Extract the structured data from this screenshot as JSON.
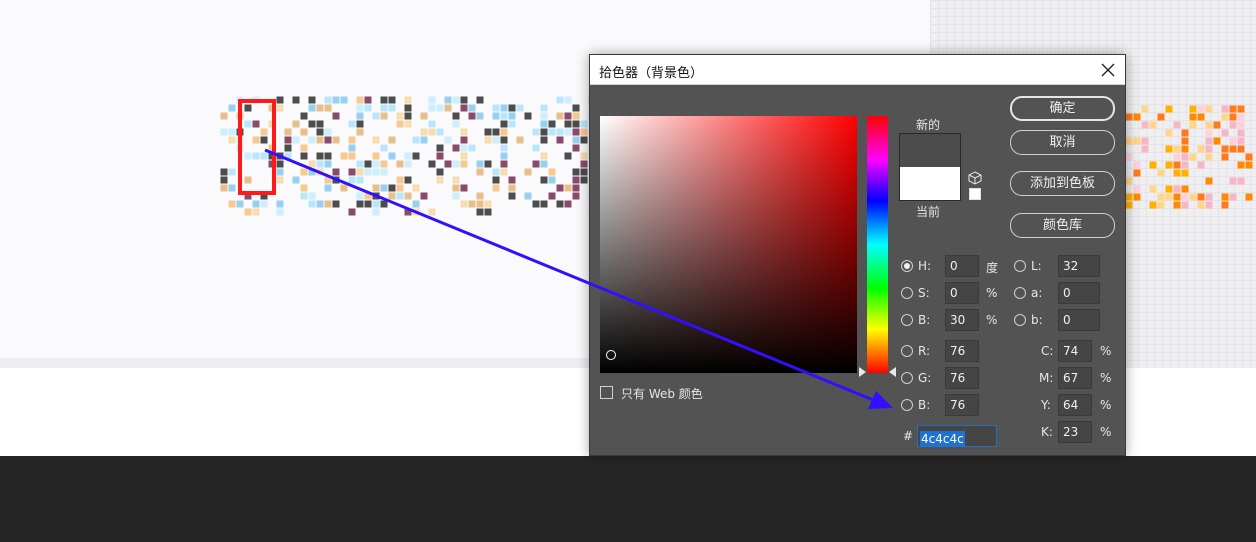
{
  "dialog": {
    "title": "拾色器（背景色）",
    "new_label": "新的",
    "current_label": "当前",
    "new_color": "#4c4c4c",
    "current_color": "#ffffff",
    "buttons": {
      "ok": "确定",
      "cancel": "取消",
      "add_to_swatches": "添加到色板",
      "color_libraries": "颜色库"
    },
    "fields": {
      "h": {
        "label": "H:",
        "value": "0",
        "unit": "度"
      },
      "s": {
        "label": "S:",
        "value": "0",
        "unit": "%"
      },
      "b": {
        "label": "B:",
        "value": "30",
        "unit": "%"
      },
      "r": {
        "label": "R:",
        "value": "76"
      },
      "g": {
        "label": "G:",
        "value": "76"
      },
      "b2": {
        "label": "B:",
        "value": "76"
      },
      "l": {
        "label": "L:",
        "value": "32"
      },
      "a": {
        "label": "a:",
        "value": "0"
      },
      "lab_b": {
        "label": "b:",
        "value": "0"
      },
      "c": {
        "label": "C:",
        "value": "74",
        "unit": "%"
      },
      "m": {
        "label": "M:",
        "value": "67",
        "unit": "%"
      },
      "y": {
        "label": "Y:",
        "value": "64",
        "unit": "%"
      },
      "k": {
        "label": "K:",
        "value": "23",
        "unit": "%"
      }
    },
    "selected_mode": "H",
    "hex": {
      "label": "#",
      "value": "4c4c4c"
    },
    "web_colors_only": {
      "label": "只有 Web 颜色",
      "checked": false
    }
  },
  "canvas": {
    "highlight_color": "#ff1a1a",
    "arrow_color": "#3010ff"
  }
}
